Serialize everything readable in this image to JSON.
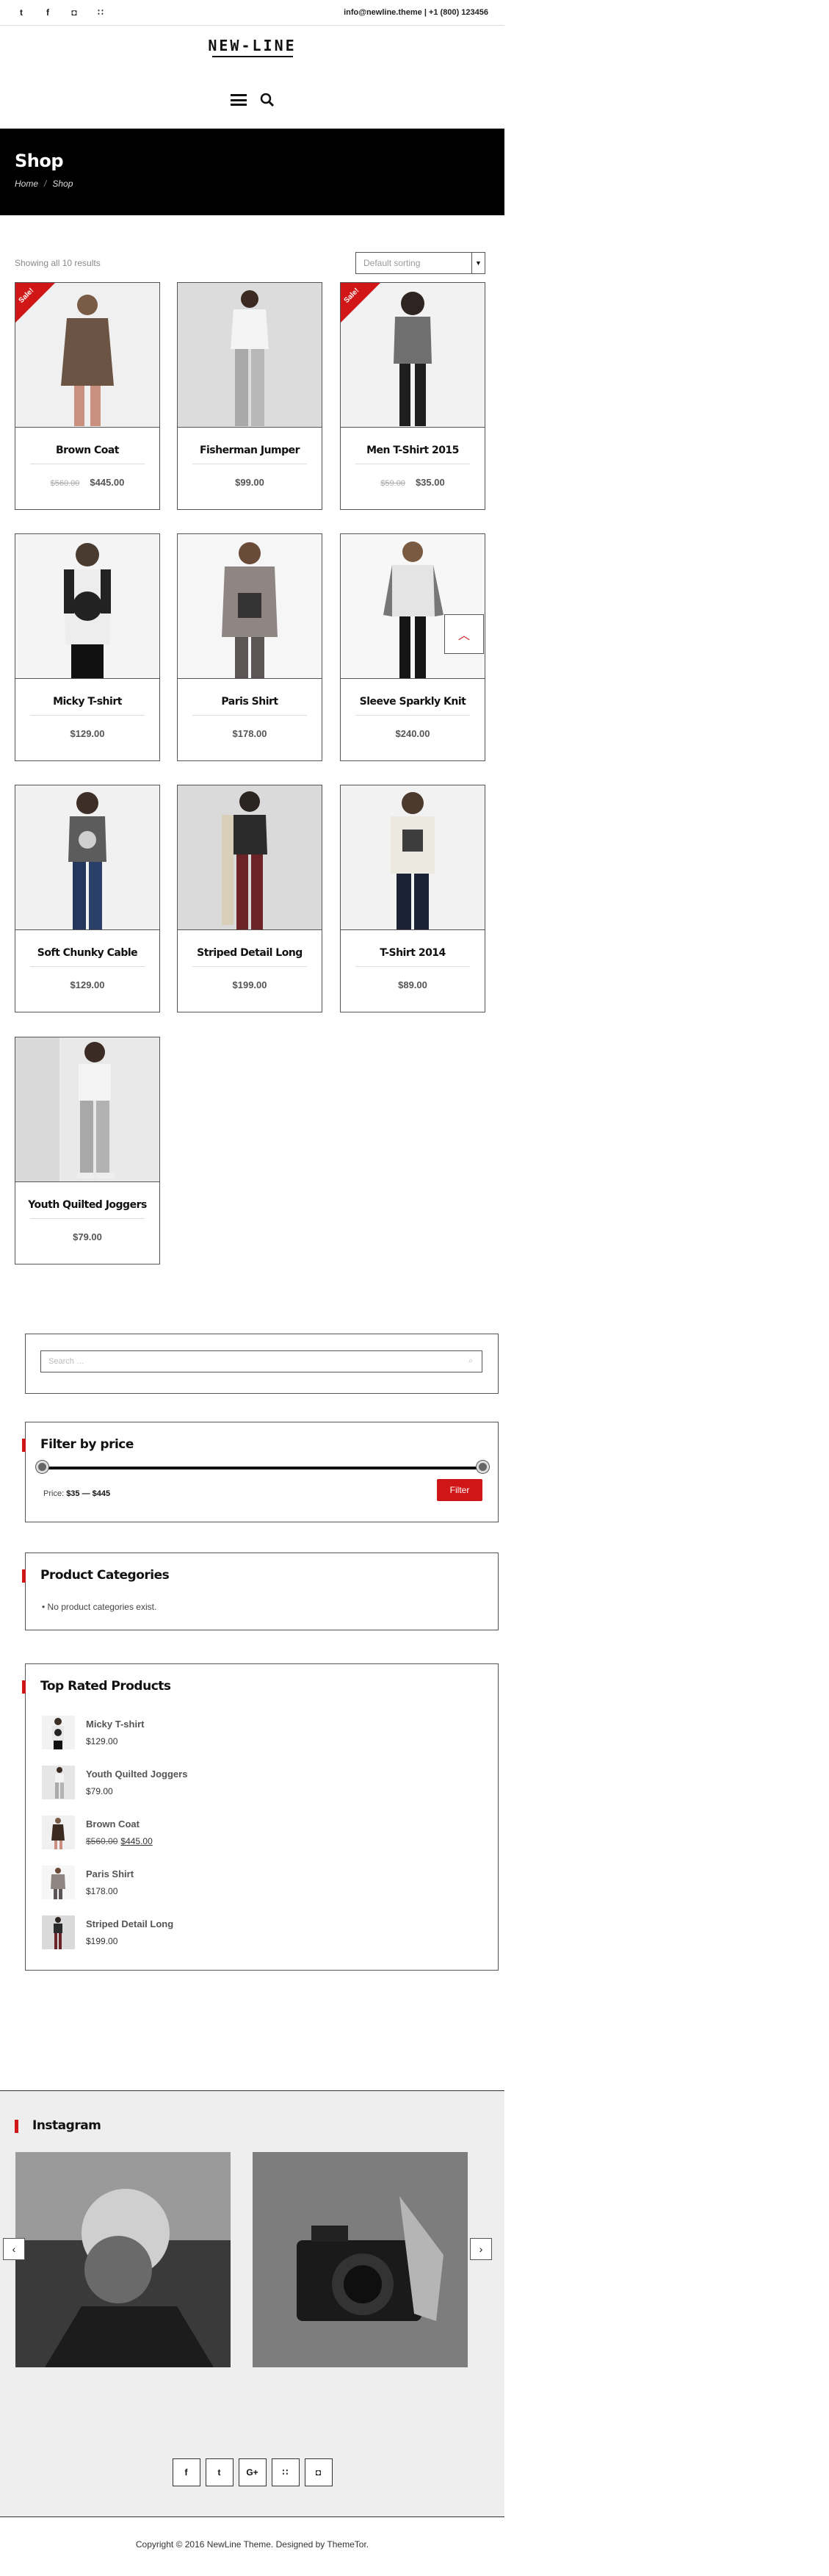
{
  "topbar": {
    "socials": [
      {
        "icon": "twitter-icon",
        "glyph": "t"
      },
      {
        "icon": "facebook-icon",
        "glyph": "f"
      },
      {
        "icon": "instagram-icon",
        "glyph": "◘"
      },
      {
        "icon": "rss-icon",
        "glyph": "∷"
      }
    ],
    "contact": "info@newline.theme | +1 (800) 123456"
  },
  "logo": "NEW-LINE",
  "hero": {
    "title": "Shop",
    "crumb_home": "Home",
    "crumb_current": "Shop"
  },
  "shop": {
    "result_count": "Showing all 10 results",
    "sorting": "Default sorting"
  },
  "products": [
    {
      "name": "Brown Coat",
      "old_price": "$560.00",
      "price": "$445.00",
      "sale": "Sale!"
    },
    {
      "name": "Fisherman Jumper",
      "old_price": "",
      "price": "$99.00",
      "sale": ""
    },
    {
      "name": "Men T-Shirt 2015",
      "old_price": "$59.00",
      "price": "$35.00",
      "sale": "Sale!"
    },
    {
      "name": "Micky T-shirt",
      "old_price": "",
      "price": "$129.00",
      "sale": ""
    },
    {
      "name": "Paris Shirt",
      "old_price": "",
      "price": "$178.00",
      "sale": ""
    },
    {
      "name": "Sleeve Sparkly Knit",
      "old_price": "",
      "price": "$240.00",
      "sale": ""
    },
    {
      "name": "Soft Chunky Cable",
      "old_price": "",
      "price": "$129.00",
      "sale": ""
    },
    {
      "name": "Striped Detail Long",
      "old_price": "",
      "price": "$199.00",
      "sale": ""
    },
    {
      "name": "T-Shirt 2014",
      "old_price": "",
      "price": "$89.00",
      "sale": ""
    },
    {
      "name": "Youth Quilted Joggers",
      "old_price": "",
      "price": "$79.00",
      "sale": ""
    }
  ],
  "widgets": {
    "search_placeholder": "Search …",
    "price_filter": {
      "title": "Filter by price",
      "label": "Price:",
      "min": "$35",
      "sep": "—",
      "max": "$445",
      "button": "Filter",
      "range_min_fraction": 0,
      "range_max_fraction": 1
    },
    "categories": {
      "title": "Product Categories",
      "empty": "No product categories exist."
    },
    "top_rated": {
      "title": "Top Rated Products",
      "items": [
        {
          "name": "Micky T-shirt",
          "old_price": "",
          "price": "$129.00"
        },
        {
          "name": "Youth Quilted Joggers",
          "old_price": "",
          "price": "$79.00"
        },
        {
          "name": "Brown Coat",
          "old_price": "$560.00",
          "price": "$445.00"
        },
        {
          "name": "Paris Shirt",
          "old_price": "",
          "price": "$178.00"
        },
        {
          "name": "Striped Detail Long",
          "old_price": "",
          "price": "$199.00"
        }
      ]
    }
  },
  "instagram": {
    "title": "Instagram",
    "prev": "‹",
    "next": "›"
  },
  "footer": {
    "socials": [
      {
        "icon": "facebook-icon",
        "glyph": "f"
      },
      {
        "icon": "twitter-icon",
        "glyph": "t"
      },
      {
        "icon": "google-plus-icon",
        "glyph": "G+"
      },
      {
        "icon": "rss-icon",
        "glyph": "∷"
      },
      {
        "icon": "instagram-icon",
        "glyph": "◘"
      }
    ],
    "copyright": "Copyright © 2016 NewLine Theme. Designed by ThemeTor."
  },
  "colors": {
    "accent": "#d01616",
    "hero_bg": "#000000",
    "footer_bg": "#eeeeee"
  }
}
